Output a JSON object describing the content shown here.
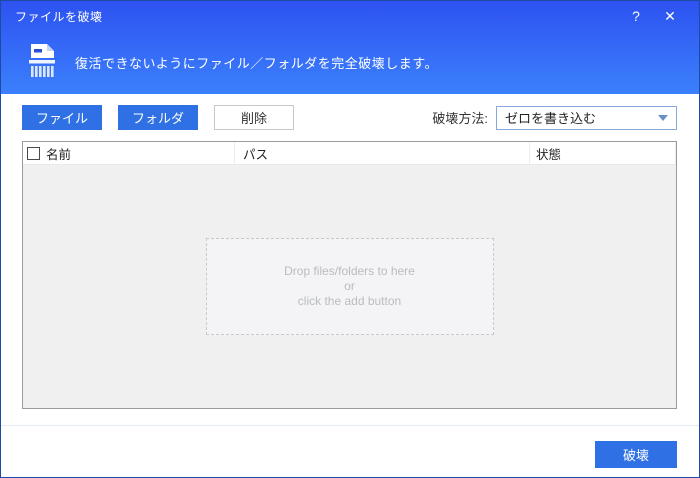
{
  "window": {
    "title": "ファイルを破壊",
    "help_label": "?",
    "close_label": "✕"
  },
  "header": {
    "icon": "shredder-icon",
    "description": "復活できないようにファイル／フォルダを完全破壊します。"
  },
  "toolbar": {
    "file_button": "ファイル",
    "folder_button": "フォルダ",
    "delete_button": "削除",
    "method_label": "破壊方法:",
    "method_selected": "ゼロを書き込む"
  },
  "table": {
    "columns": {
      "name": "名前",
      "path": "パス",
      "status": "状態"
    },
    "rows": [],
    "select_all_checked": false
  },
  "dropzone": {
    "lines": [
      "Drop files/folders to here",
      "or",
      "click the add button"
    ]
  },
  "footer": {
    "destroy_button": "破壊"
  },
  "colors": {
    "titlebar_gradient_top": "#2d52f1",
    "titlebar_gradient_bottom": "#3b80fc",
    "accent_button_blue": "#2f70e5",
    "window_border": "#1d4ba2",
    "combobox_border": "#87a9db",
    "table_border": "#9a9aa0",
    "table_body_bg": "#f0f0f1",
    "dropzone_text": "#b9bcbf"
  }
}
